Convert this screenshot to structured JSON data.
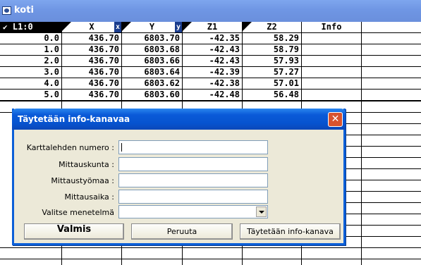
{
  "window": {
    "title": "koti"
  },
  "grid": {
    "columns": [
      {
        "label": "L1:0",
        "tag": ""
      },
      {
        "label": "X",
        "tag": "x"
      },
      {
        "label": "Y",
        "tag": "y"
      },
      {
        "label": "Z1",
        "tag": ""
      },
      {
        "label": "Z2",
        "tag": ""
      },
      {
        "label": "Info",
        "tag": ""
      }
    ],
    "rows": [
      [
        "0.0",
        "436.70",
        "6803.70",
        "-42.35",
        "58.29",
        ""
      ],
      [
        "1.0",
        "436.70",
        "6803.68",
        "-42.43",
        "58.79",
        ""
      ],
      [
        "2.0",
        "436.70",
        "6803.66",
        "-42.43",
        "57.93",
        ""
      ],
      [
        "3.0",
        "436.70",
        "6803.64",
        "-42.39",
        "57.27",
        ""
      ],
      [
        "4.0",
        "436.70",
        "6803.62",
        "-42.38",
        "57.01",
        ""
      ],
      [
        "5.0",
        "436.70",
        "6803.60",
        "-42.48",
        "56.48",
        ""
      ]
    ]
  },
  "dialog": {
    "title": "Täytetään info-kanavaa",
    "fields": [
      {
        "label": "Karttalehden numero :",
        "value": ""
      },
      {
        "label": "Mittauskunta :",
        "value": ""
      },
      {
        "label": "Mittaustyömaa :",
        "value": ""
      },
      {
        "label": "Mittausaika :",
        "value": ""
      }
    ],
    "method": {
      "label": "Valitse menetelmä",
      "value": ""
    },
    "buttons": {
      "ok": "Valmis",
      "cancel": "Peruuta",
      "fill": "Täytetään info-kanava"
    }
  }
}
